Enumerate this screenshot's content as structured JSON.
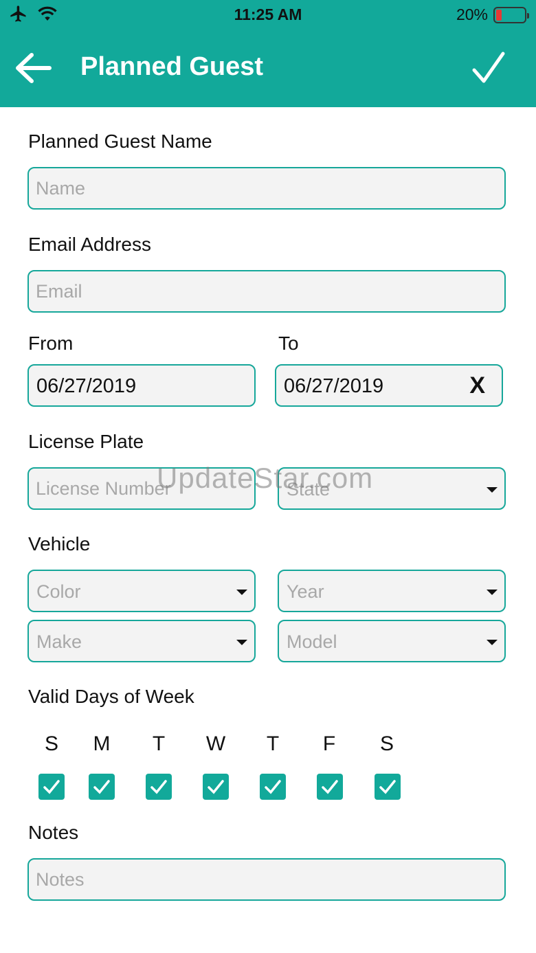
{
  "status_bar": {
    "time": "11:25 AM",
    "battery_percent": "20%",
    "battery_level": 0.2,
    "icons": [
      "airplane-icon",
      "wifi-icon",
      "battery-icon"
    ]
  },
  "app_bar": {
    "title": "Planned Guest",
    "back_icon": "arrow-left-icon",
    "confirm_icon": "checkmark-icon",
    "background": "#12a99a"
  },
  "form": {
    "guest_name": {
      "label": "Planned Guest Name",
      "placeholder": "Name",
      "value": ""
    },
    "email": {
      "label": "Email Address",
      "placeholder": "Email",
      "value": ""
    },
    "from": {
      "label": "From",
      "value": "06/27/2019"
    },
    "to": {
      "label": "To",
      "value": "06/27/2019",
      "clear_label": "X"
    },
    "license_plate": {
      "label": "License Plate",
      "number_placeholder": "License Number",
      "state_placeholder": "State"
    },
    "vehicle": {
      "label": "Vehicle",
      "color_placeholder": "Color",
      "year_placeholder": "Year",
      "make_placeholder": "Make",
      "model_placeholder": "Model"
    },
    "valid_days": {
      "label": "Valid Days of Week",
      "days": [
        {
          "letter": "S",
          "checked": true
        },
        {
          "letter": "M",
          "checked": true
        },
        {
          "letter": "T",
          "checked": true
        },
        {
          "letter": "W",
          "checked": true
        },
        {
          "letter": "T",
          "checked": true
        },
        {
          "letter": "F",
          "checked": true
        },
        {
          "letter": "S",
          "checked": true
        }
      ]
    },
    "notes": {
      "label": "Notes",
      "placeholder": "Notes",
      "value": ""
    }
  },
  "watermark": "UpdateStar.com",
  "colors": {
    "accent": "#12a99a",
    "field_border": "#16a79a",
    "field_bg": "#f3f3f3",
    "placeholder": "#a8a8a8"
  }
}
